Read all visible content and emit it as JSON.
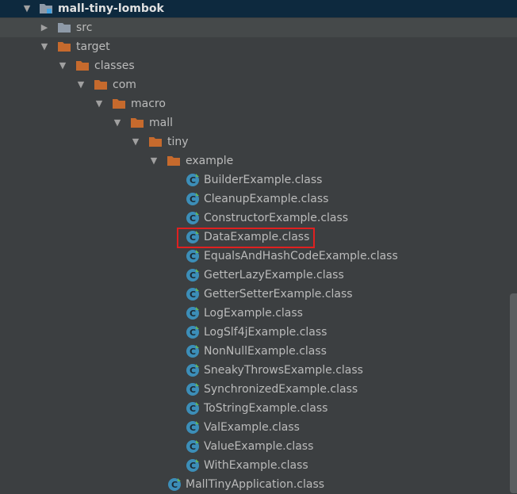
{
  "tree": {
    "project": "mall-tiny-lombok",
    "src": "src",
    "target": "target",
    "classes": "classes",
    "com": "com",
    "macro": "macro",
    "mall": "mall",
    "tiny": "tiny",
    "example": "example",
    "classes_list": [
      "BuilderExample.class",
      "CleanupExample.class",
      "ConstructorExample.class",
      "DataExample.class",
      "EqualsAndHashCodeExample.class",
      "GetterLazyExample.class",
      "GetterSetterExample.class",
      "LogExample.class",
      "LogSlf4jExample.class",
      "NonNullExample.class",
      "SneakyThrowsExample.class",
      "SynchronizedExample.class",
      "ToStringExample.class",
      "ValExample.class",
      "ValueExample.class",
      "WithExample.class"
    ],
    "app_class": "MallTinyApplication.class",
    "highlighted": "DataExample.class"
  },
  "colors": {
    "background": "#3c3f41",
    "selection": "#0d293e",
    "folder": "#c66a2d",
    "class_icon": "#3c8eb8",
    "highlight_box": "#e02020"
  },
  "icons": {
    "expanded": "triangle-down-icon",
    "collapsed": "triangle-right-icon",
    "folder": "folder-icon",
    "class": "java-class-icon",
    "project": "project-folder-icon"
  }
}
